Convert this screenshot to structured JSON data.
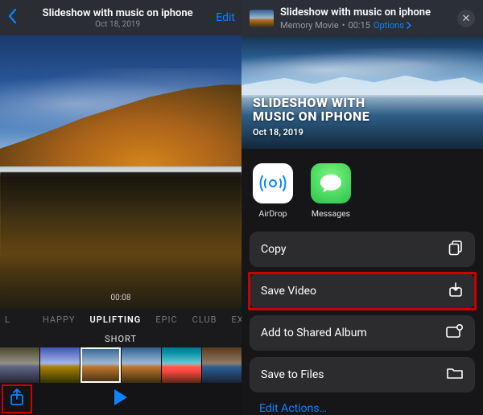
{
  "left": {
    "nav": {
      "title": "Slideshow with music on iphone",
      "subtitle": "Oct 18, 2019",
      "edit": "Edit"
    },
    "timestamp": "00:08",
    "categories": {
      "items": [
        "L",
        "HAPPY",
        "UPLIFTING",
        "EPIC",
        "CLUB",
        "EX"
      ],
      "selected_index": 2
    },
    "duration": "SHORT"
  },
  "right": {
    "card": {
      "title": "Slideshow with music on iphone",
      "subtitle_kind": "Memory Movie",
      "subtitle_time": "00:15",
      "options": "Options"
    },
    "hero": {
      "line1": "SLIDESHOW WITH",
      "line2": "MUSIC ON IPHONE",
      "date": "Oct 18, 2019"
    },
    "apps": {
      "airdrop": "AirDrop",
      "messages": "Messages"
    },
    "actions": {
      "copy": "Copy",
      "save_video": "Save Video",
      "add_shared": "Add to Shared Album",
      "save_files": "Save to Files"
    },
    "edit_actions": "Edit Actions…"
  }
}
